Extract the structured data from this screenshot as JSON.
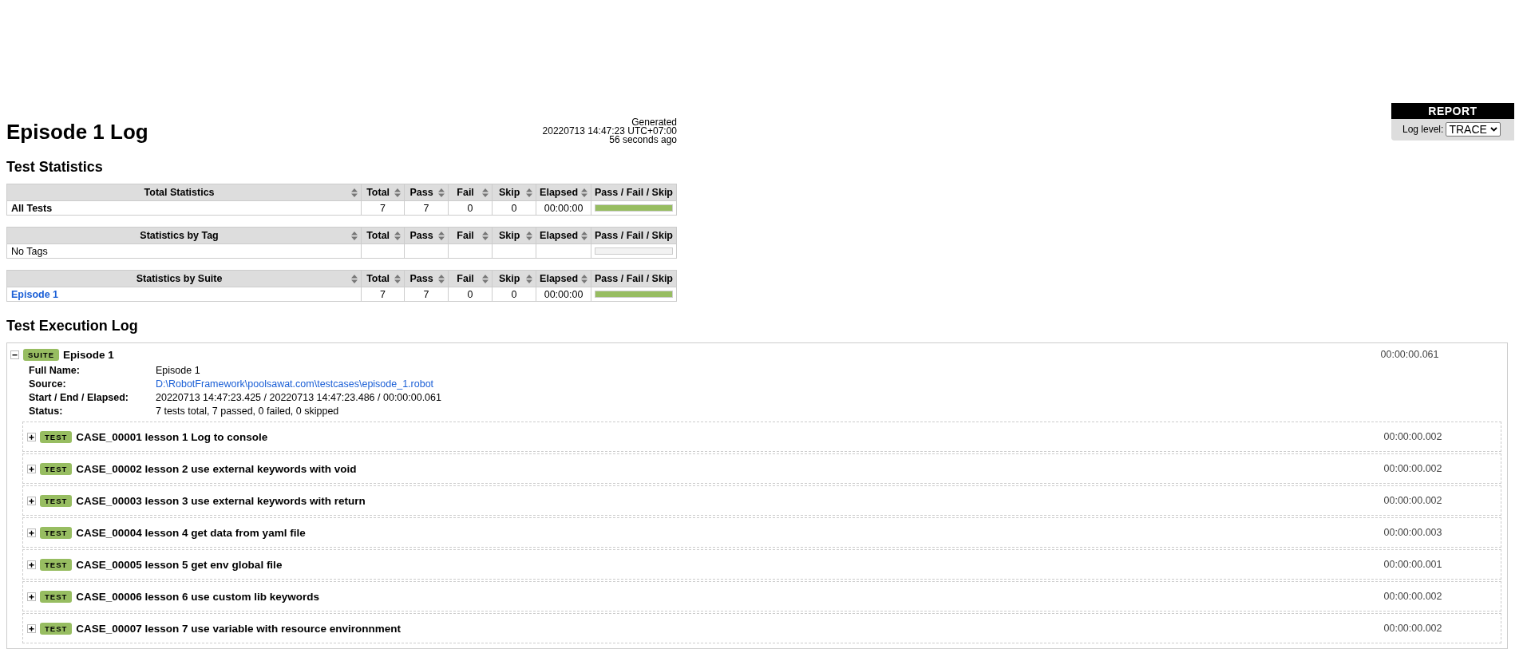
{
  "header": {
    "title": "Episode 1 Log",
    "generated": [
      "Generated",
      "20220713 14:47:23 UTC+07:00",
      "56 seconds ago"
    ]
  },
  "report_panel": {
    "title": "REPORT",
    "log_level_label": "Log level:",
    "log_level_value": "TRACE"
  },
  "statistics": {
    "title": "Test Statistics",
    "tables": [
      {
        "columns": [
          "Total Statistics",
          "Total",
          "Pass",
          "Fail",
          "Skip",
          "Elapsed",
          "Pass / Fail / Skip"
        ],
        "rows": [
          {
            "name": "All Tests",
            "kind": "bold",
            "total": "7",
            "pass": "7",
            "fail": "0",
            "skip": "0",
            "elapsed": "00:00:00",
            "level": 1
          }
        ]
      },
      {
        "columns": [
          "Statistics by Tag",
          "Total",
          "Pass",
          "Fail",
          "Skip",
          "Elapsed",
          "Pass / Fail / Skip"
        ],
        "rows": [
          {
            "name": "No Tags",
            "kind": "plain"
          }
        ]
      },
      {
        "columns": [
          "Statistics by Suite",
          "Total",
          "Pass",
          "Fail",
          "Skip",
          "Elapsed",
          "Pass / Fail / Skip"
        ],
        "rows": [
          {
            "name": "Episode 1",
            "kind": "link",
            "total": "7",
            "pass": "7",
            "fail": "0",
            "skip": "0",
            "elapsed": "00:00:00",
            "level": 1
          }
        ]
      }
    ]
  },
  "execution_log": {
    "title": "Test Execution Log",
    "suite": {
      "badge": "SUITE",
      "name": "Episode 1",
      "elapsed": "00:00:00.061",
      "expanded": true,
      "details": [
        {
          "label": "Full Name:",
          "value": "Episode 1",
          "kind": "text"
        },
        {
          "label": "Source:",
          "value": "D:\\RobotFramework\\poolsawat.com\\testcases\\episode_1.robot",
          "kind": "link"
        },
        {
          "label": "Start / End / Elapsed:",
          "value": "20220713 14:47:23.425 / 20220713 14:47:23.486 / 00:00:00.061",
          "kind": "text"
        },
        {
          "label": "Status:",
          "value": "7 tests total, 7 passed, 0 failed, 0 skipped",
          "kind": "text"
        }
      ],
      "tests": [
        {
          "badge": "TEST",
          "name": "CASE_00001 lesson 1 Log to console",
          "elapsed": "00:00:00.002",
          "expanded": false
        },
        {
          "badge": "TEST",
          "name": "CASE_00002 lesson 2 use external keywords with void",
          "elapsed": "00:00:00.002",
          "expanded": false
        },
        {
          "badge": "TEST",
          "name": "CASE_00003 lesson 3 use external keywords with return",
          "elapsed": "00:00:00.002",
          "expanded": false
        },
        {
          "badge": "TEST",
          "name": "CASE_00004 lesson 4 get data from yaml file",
          "elapsed": "00:00:00.003",
          "expanded": false
        },
        {
          "badge": "TEST",
          "name": "CASE_00005 lesson 5 get env global file",
          "elapsed": "00:00:00.001",
          "expanded": false
        },
        {
          "badge": "TEST",
          "name": "CASE_00006 lesson 6 use custom lib keywords",
          "elapsed": "00:00:00.002",
          "expanded": false
        },
        {
          "badge": "TEST",
          "name": "CASE_00007 lesson 7 use variable with resource environnment",
          "elapsed": "00:00:00.002",
          "expanded": false
        }
      ]
    }
  }
}
